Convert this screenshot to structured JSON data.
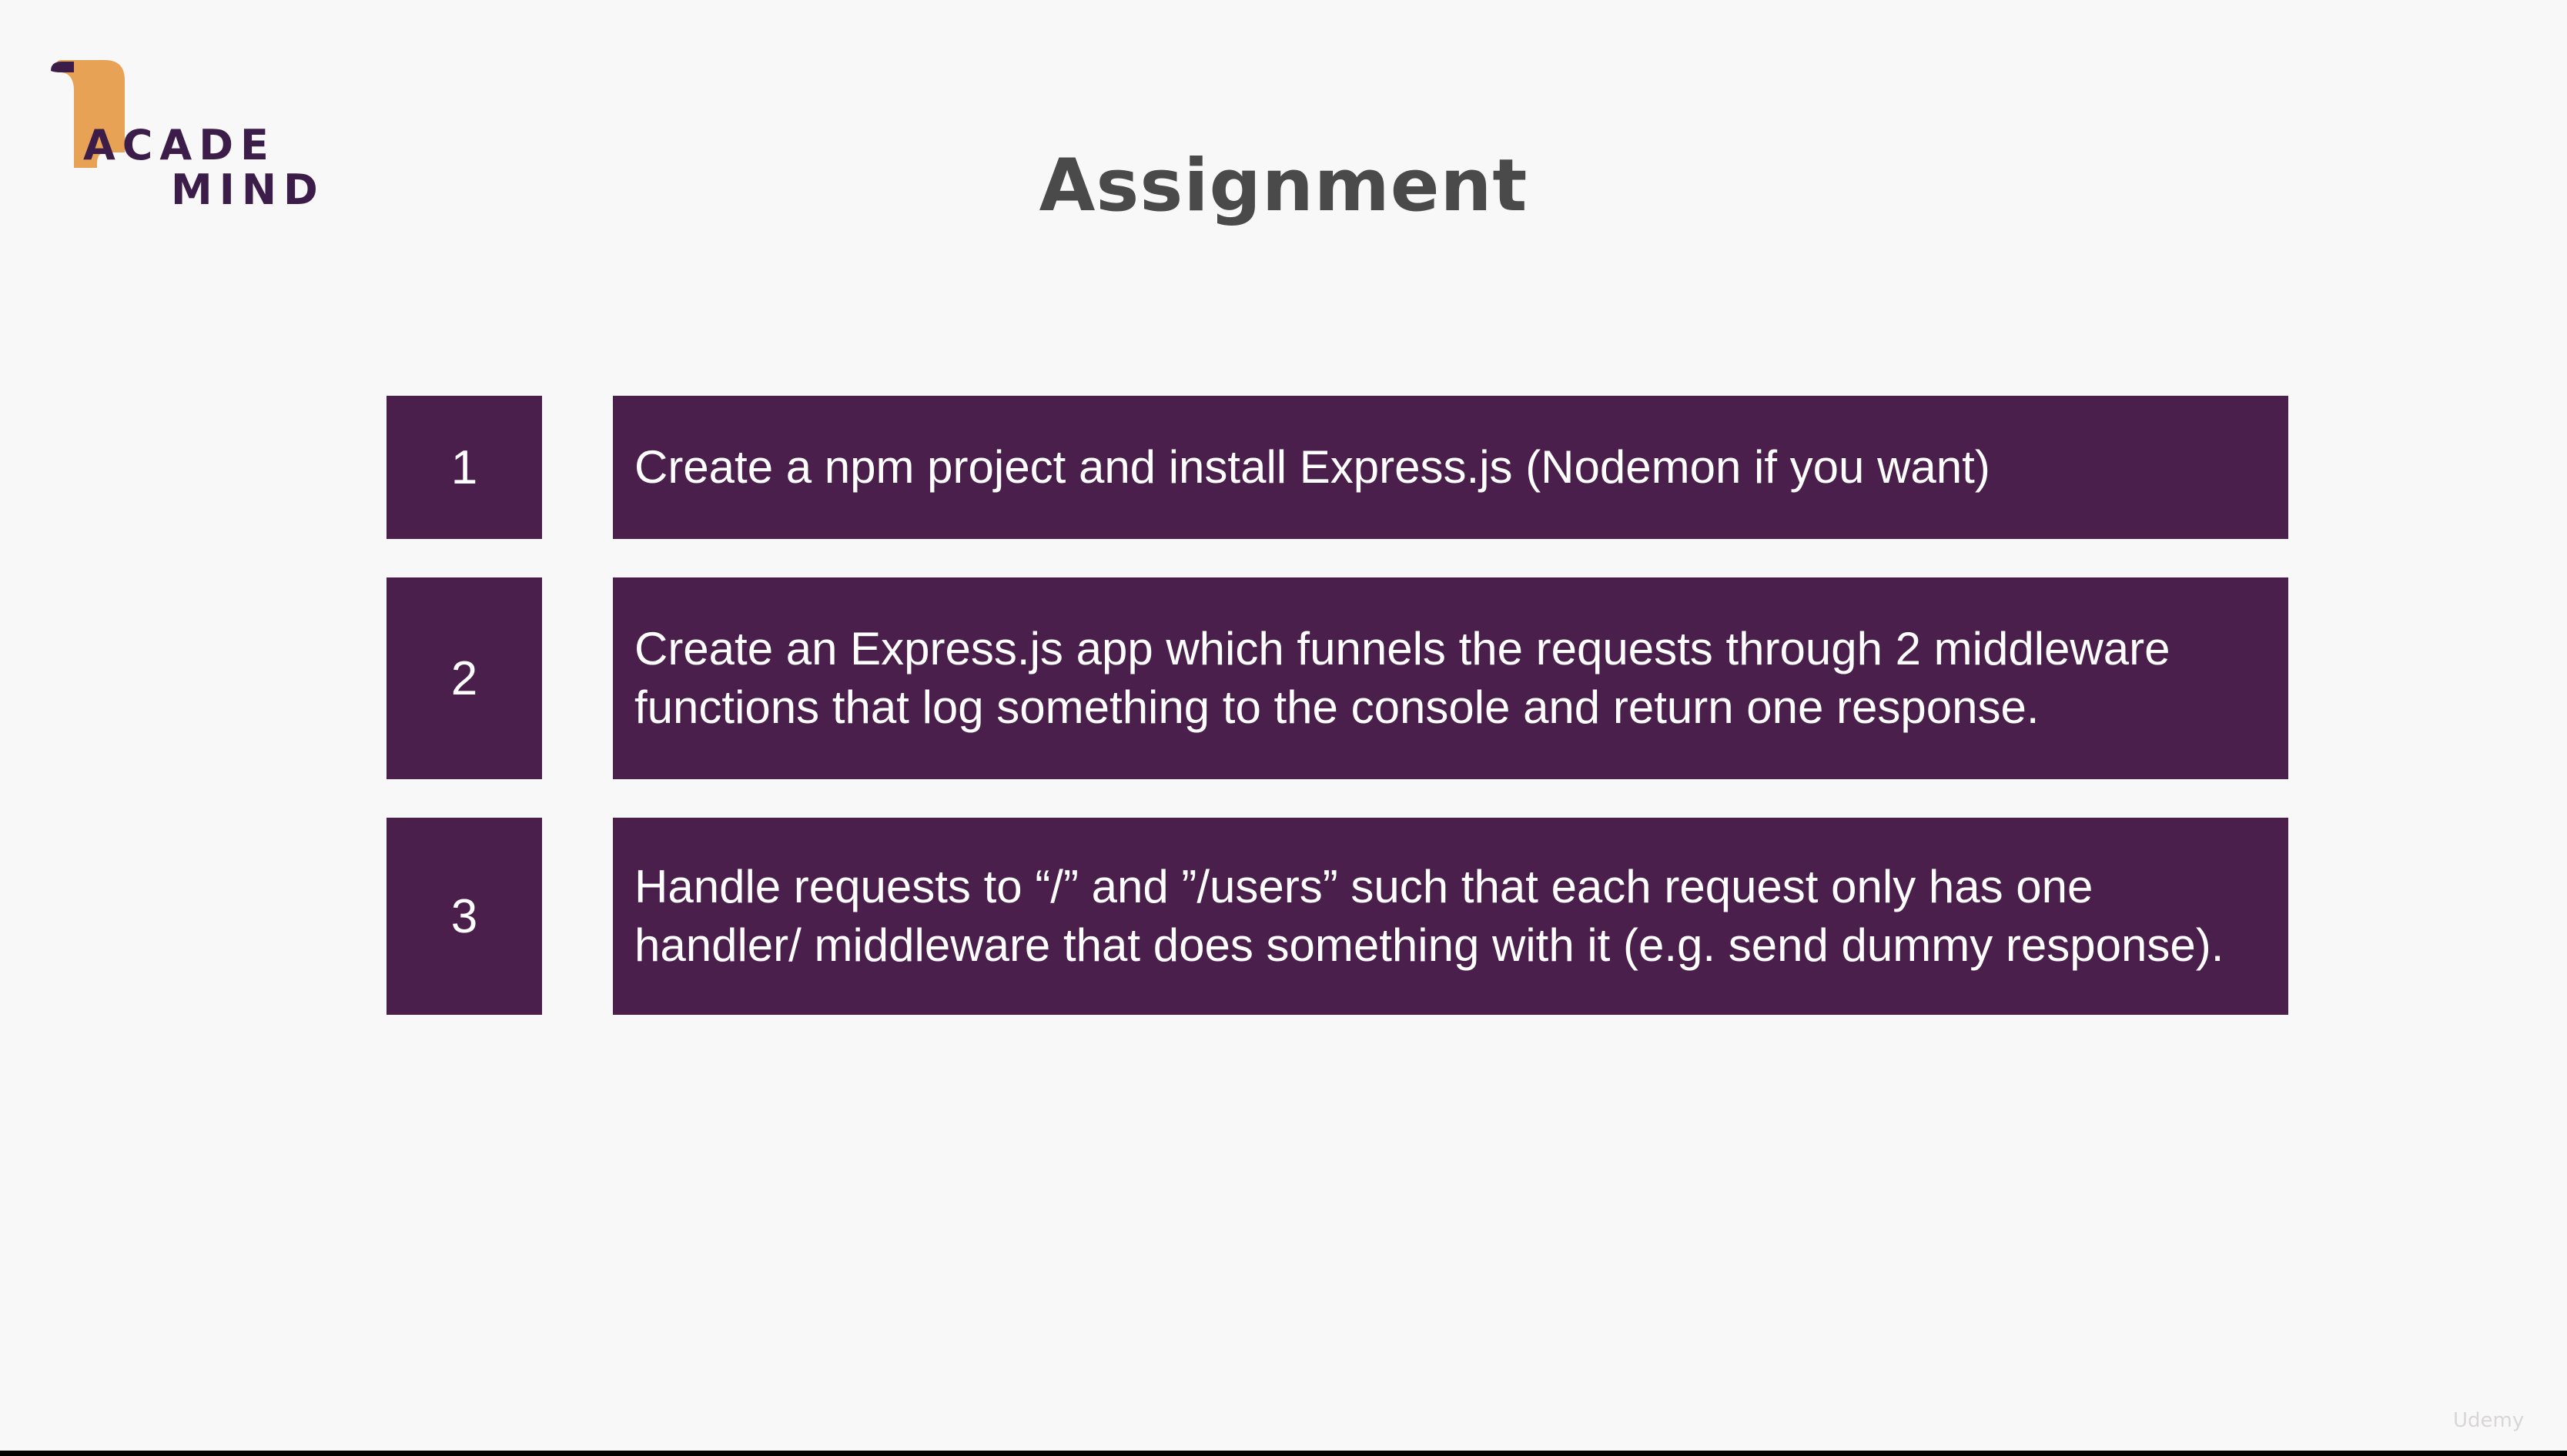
{
  "logo": {
    "line1": "ACADE",
    "line2": "MIND",
    "accent_color": "#e8a255",
    "text_color": "#3c1d49"
  },
  "slide": {
    "title": "Assignment"
  },
  "tasks": [
    {
      "number": "1",
      "text": "Create a npm project and install Express.js (Nodemon if you want)"
    },
    {
      "number": "2",
      "text": "Create an Express.js app which funnels the requests through 2 middleware functions that log something to the console and return one response."
    },
    {
      "number": "3",
      "text": "Handle requests to “/” and ”/users” such that each request only has one handler/ middleware that does something with it (e.g. send dummy response)."
    }
  ],
  "colors": {
    "box_background": "#4a1f4b",
    "slide_background": "#f9f8f8",
    "title_color": "#4a4a4a"
  },
  "watermark": {
    "text": "Udemy"
  }
}
